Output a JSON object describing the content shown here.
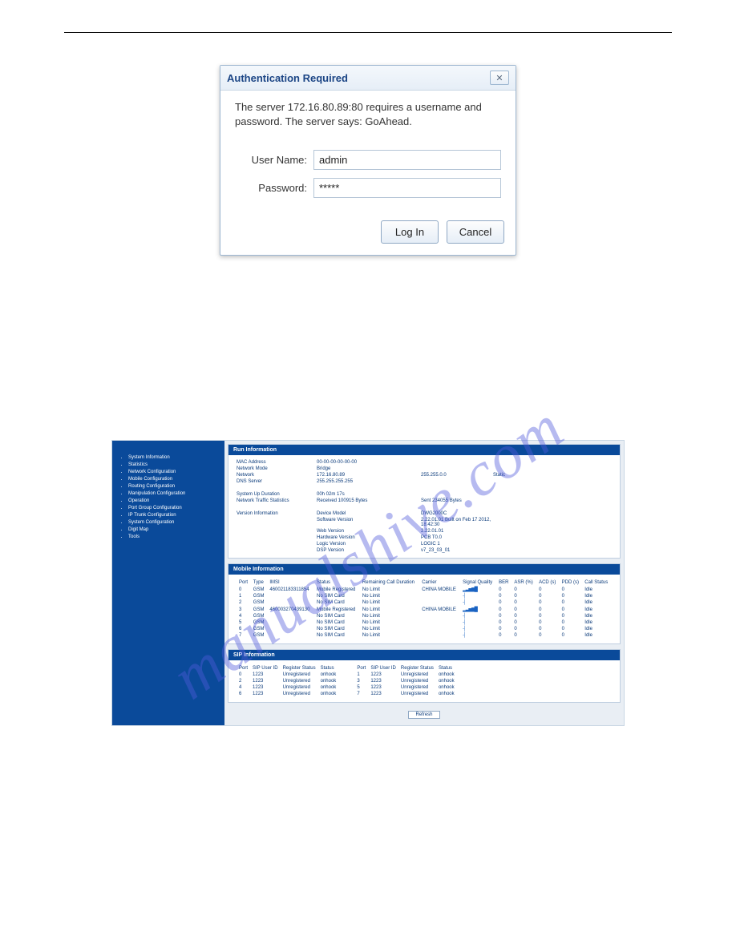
{
  "watermark": "manualshive.com",
  "auth": {
    "title": "Authentication Required",
    "message": "The server 172.16.80.89:80 requires a username and password. The server says: GoAhead.",
    "username_label": "User Name:",
    "username_value": "admin",
    "password_label": "Password:",
    "password_value": "*****",
    "login_label": "Log In",
    "cancel_label": "Cancel",
    "close_glyph": "✕"
  },
  "sidebar": {
    "items": [
      "System Information",
      "Statistics",
      "Network Configuration",
      "Mobile Configuration",
      "Routing Configuration",
      "Manipulation Configuration",
      "Operation",
      "Port Group Configuration",
      "IP Trunk Configuration",
      "System Configuration",
      "Digit Map",
      "Tools"
    ]
  },
  "run": {
    "title": "Run Information",
    "rows": [
      {
        "label": "MAC Address",
        "v1": "00-00-00-00-00-00",
        "v2": "",
        "v3": ""
      },
      {
        "label": "Network Mode",
        "v1": "Bridge",
        "v2": "",
        "v3": ""
      },
      {
        "label": "Network",
        "v1": "172.16.80.89",
        "v2": "255.255.0.0",
        "v3": "Static"
      },
      {
        "label": "DNS Server",
        "v1": "255.255.255.255",
        "v2": "",
        "v3": ""
      }
    ],
    "rows2": [
      {
        "label": "System Up Duration",
        "v1": "00h 02m 17s",
        "v2": "",
        "v3": ""
      },
      {
        "label": "Network Traffic Statistics",
        "v1": "Received 100915 Bytes",
        "v2": "Sent 234055 Bytes",
        "v3": ""
      }
    ],
    "rows3": [
      {
        "label": "Version Information",
        "v1": "Device Model",
        "v2": "DWG2000C",
        "v3": ""
      },
      {
        "label": "",
        "v1": "Software Version",
        "v2": "2.22.01.01 Built on Feb 17 2012, 18:42:30",
        "v3": ""
      },
      {
        "label": "",
        "v1": "Web Version",
        "v2": "2.22.01.01",
        "v3": ""
      },
      {
        "label": "",
        "v1": "Hardware Version",
        "v2": "PCB T0.0",
        "v3": ""
      },
      {
        "label": "",
        "v1": "Logic Version",
        "v2": "LOGIC 1",
        "v3": ""
      },
      {
        "label": "",
        "v1": "DSP Version",
        "v2": "v7_23_03_01",
        "v3": ""
      }
    ]
  },
  "mobile": {
    "title": "Mobile Information",
    "headers": [
      "Port",
      "Type",
      "IMSI",
      "Status",
      "Remaining Call Duration",
      "Carrier",
      "Signal Quality",
      "BER",
      "ASR (%)",
      "ACD (s)",
      "PDD (s)",
      "Call Status"
    ],
    "rows": [
      {
        "port": "0",
        "type": "GSM",
        "imsi": "460021183311854",
        "status": "Mobile Registered",
        "rem": "No Limit",
        "carrier": "CHINA MOBILE",
        "sig": "▂▃▅▆█",
        "ber": "0",
        "asr": "0",
        "acd": "0",
        "pdd": "0",
        "call": "Idle"
      },
      {
        "port": "1",
        "type": "GSM",
        "imsi": "",
        "status": "No SIM Card",
        "rem": "No Limit",
        "carrier": "",
        "sig": "┤",
        "ber": "0",
        "asr": "0",
        "acd": "0",
        "pdd": "0",
        "call": "Idle"
      },
      {
        "port": "2",
        "type": "GSM",
        "imsi": "",
        "status": "No SIM Card",
        "rem": "No Limit",
        "carrier": "",
        "sig": "┤",
        "ber": "0",
        "asr": "0",
        "acd": "0",
        "pdd": "0",
        "call": "Idle"
      },
      {
        "port": "3",
        "type": "GSM",
        "imsi": "460003270439130",
        "status": "Mobile Registered",
        "rem": "No Limit",
        "carrier": "CHINA MOBILE",
        "sig": "▂▃▅▆█",
        "ber": "0",
        "asr": "0",
        "acd": "0",
        "pdd": "0",
        "call": "Idle"
      },
      {
        "port": "4",
        "type": "GSM",
        "imsi": "",
        "status": "No SIM Card",
        "rem": "No Limit",
        "carrier": "",
        "sig": "┤",
        "ber": "0",
        "asr": "0",
        "acd": "0",
        "pdd": "0",
        "call": "Idle"
      },
      {
        "port": "5",
        "type": "GSM",
        "imsi": "",
        "status": "No SIM Card",
        "rem": "No Limit",
        "carrier": "",
        "sig": "┤",
        "ber": "0",
        "asr": "0",
        "acd": "0",
        "pdd": "0",
        "call": "Idle"
      },
      {
        "port": "6",
        "type": "GSM",
        "imsi": "",
        "status": "No SIM Card",
        "rem": "No Limit",
        "carrier": "",
        "sig": "┤",
        "ber": "0",
        "asr": "0",
        "acd": "0",
        "pdd": "0",
        "call": "Idle"
      },
      {
        "port": "7",
        "type": "GSM",
        "imsi": "",
        "status": "No SIM Card",
        "rem": "No Limit",
        "carrier": "",
        "sig": "┤",
        "ber": "0",
        "asr": "0",
        "acd": "0",
        "pdd": "0",
        "call": "Idle"
      }
    ]
  },
  "sip": {
    "title": "SIP Information",
    "headers": [
      "Port",
      "SIP User ID",
      "Register Status",
      "Status"
    ],
    "left": [
      {
        "port": "0",
        "uid": "1223",
        "reg": "Unregistered",
        "st": "onhook"
      },
      {
        "port": "2",
        "uid": "1223",
        "reg": "Unregistered",
        "st": "onhook"
      },
      {
        "port": "4",
        "uid": "1223",
        "reg": "Unregistered",
        "st": "onhook"
      },
      {
        "port": "6",
        "uid": "1223",
        "reg": "Unregistered",
        "st": "onhook"
      }
    ],
    "right": [
      {
        "port": "1",
        "uid": "1223",
        "reg": "Unregistered",
        "st": "onhook"
      },
      {
        "port": "3",
        "uid": "1223",
        "reg": "Unregistered",
        "st": "onhook"
      },
      {
        "port": "5",
        "uid": "1223",
        "reg": "Unregistered",
        "st": "onhook"
      },
      {
        "port": "7",
        "uid": "1223",
        "reg": "Unregistered",
        "st": "onhook"
      }
    ]
  },
  "refresh_label": "Refresh"
}
